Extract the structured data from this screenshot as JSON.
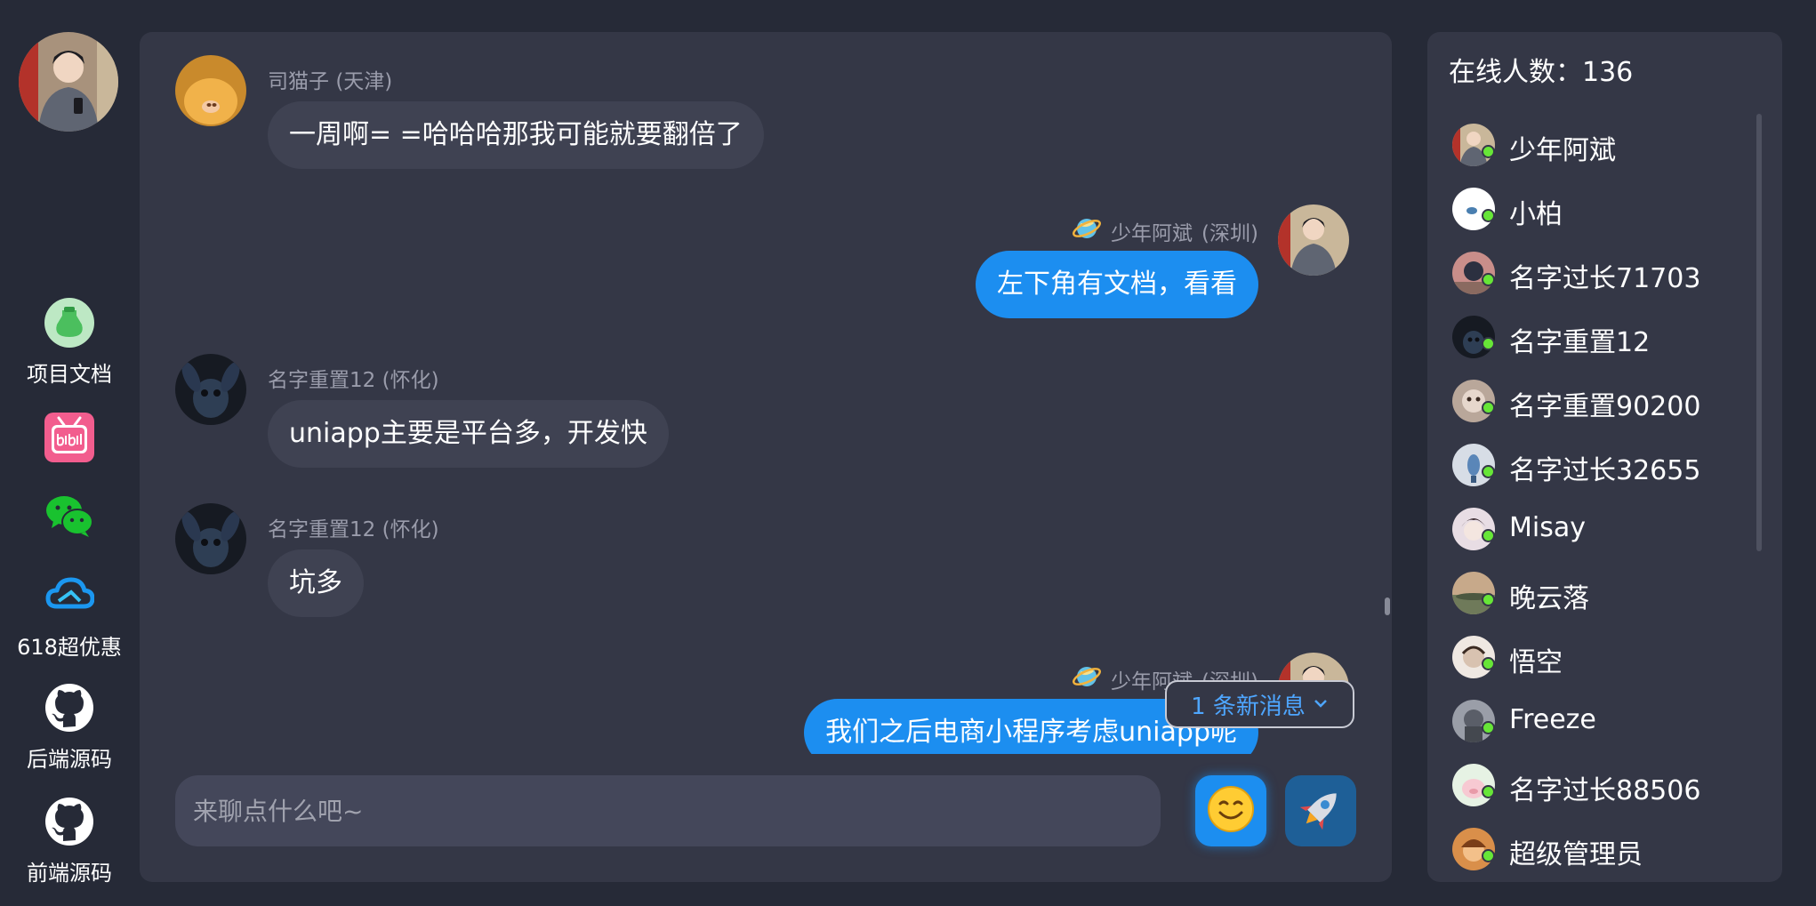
{
  "sidebar": {
    "items": [
      {
        "label": "项目文档",
        "icon": "project-docs-icon"
      },
      {
        "label": "",
        "icon": "bilibili-icon"
      },
      {
        "label": "",
        "icon": "wechat-icon"
      },
      {
        "label": "618超优惠",
        "icon": "cloud-icon"
      },
      {
        "label": "后端源码",
        "icon": "github-icon"
      },
      {
        "label": "前端源码",
        "icon": "github-icon"
      }
    ]
  },
  "chat": {
    "messages": [
      {
        "side": "left",
        "user": "司猫子",
        "location": "(天津)",
        "text": "一周啊= =哈哈哈那我可能就要翻倍了"
      },
      {
        "side": "right",
        "user": "少年阿斌",
        "location": "(深圳)",
        "text": "左下角有文档，看看"
      },
      {
        "side": "left",
        "user": "名字重置12",
        "location": "(怀化)",
        "text": "uniapp主要是平台多，开发快"
      },
      {
        "side": "left",
        "user": "名字重置12",
        "location": "(怀化)",
        "text": "坑多"
      },
      {
        "side": "right",
        "user": "少年阿斌",
        "location": "(深圳)",
        "text": "我们之后电商小程序考虑uniapp呢"
      }
    ],
    "new_message_badge": "1 条新消息",
    "input_placeholder": "来聊点什么吧~"
  },
  "online": {
    "count_label": "在线人数：136",
    "users": [
      "少年阿斌",
      "小柏",
      "名字过长71703",
      "名字重置12",
      "名字重置90200",
      "名字过长32655",
      "Misay",
      "晚云落",
      "悟空",
      "Freeze",
      "名字过长88506",
      "超级管理员"
    ]
  },
  "colors": {
    "background": "#262a37",
    "panel": "#343746",
    "accent": "#1c8ef0",
    "online_dot": "#67e637"
  }
}
